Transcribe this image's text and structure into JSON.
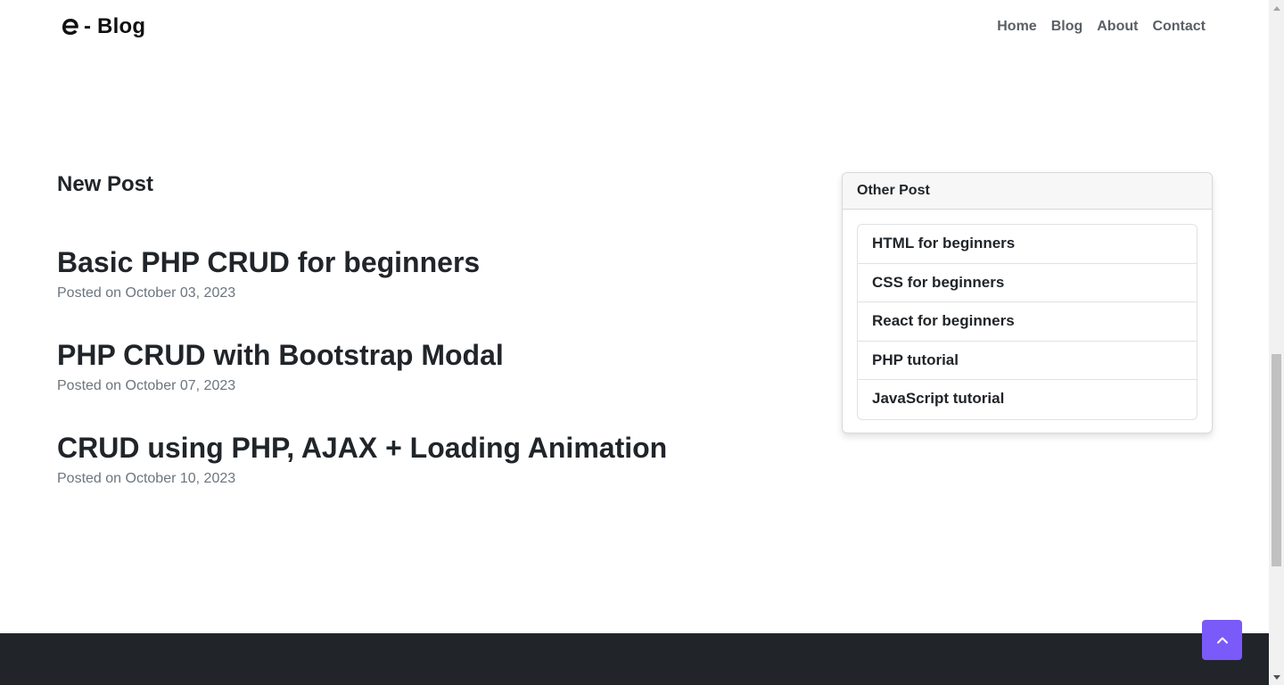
{
  "navbar": {
    "brand_text": "- Blog",
    "links": [
      "Home",
      "Blog",
      "About",
      "Contact"
    ]
  },
  "main": {
    "section_title": "New Post",
    "posts": [
      {
        "title": "Basic PHP CRUD for beginners",
        "meta": "Posted on October 03, 2023"
      },
      {
        "title": "PHP CRUD with Bootstrap Modal",
        "meta": "Posted on October 07, 2023"
      },
      {
        "title": "CRUD using PHP, AJAX + Loading Animation",
        "meta": "Posted on October 10, 2023"
      }
    ]
  },
  "sidebar": {
    "header": "Other Post",
    "items": [
      "HTML for beginners",
      "CSS for beginners",
      "React for beginners",
      "PHP tutorial",
      "JavaScript tutorial"
    ]
  },
  "colors": {
    "accent": "#7a5af8",
    "footer": "#212529",
    "muted": "#6c757d"
  }
}
